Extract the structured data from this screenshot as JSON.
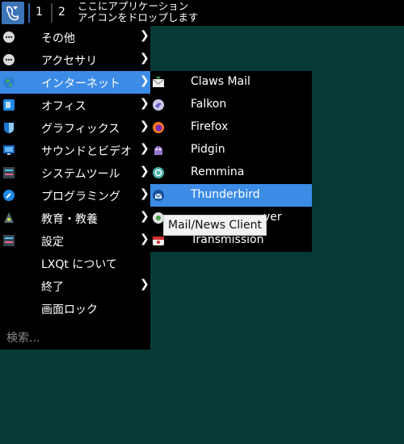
{
  "taskbar": {
    "desktop1": "1",
    "desktop2": "2",
    "hint_line1": "ここにアプリケーション",
    "hint_line2": "アイコンをドロップします",
    "start_icon": "lxqt-logo-icon"
  },
  "menu": {
    "items": [
      {
        "label": "その他",
        "icon": "more-icon",
        "has_submenu": true
      },
      {
        "label": "アクセサリ",
        "icon": "more-icon",
        "has_submenu": true
      },
      {
        "label": "インターネット",
        "icon": "globe-icon",
        "has_submenu": true,
        "active": true
      },
      {
        "label": "オフィス",
        "icon": "office-icon",
        "has_submenu": true
      },
      {
        "label": "グラフィックス",
        "icon": "graphics-icon",
        "has_submenu": true
      },
      {
        "label": "サウンドとビデオ",
        "icon": "monitor-icon",
        "has_submenu": true
      },
      {
        "label": "システムツール",
        "icon": "tools-icon",
        "has_submenu": true
      },
      {
        "label": "プログラミング",
        "icon": "wrench-icon",
        "has_submenu": true
      },
      {
        "label": "教育・教養",
        "icon": "education-icon",
        "has_submenu": true
      },
      {
        "label": "設定",
        "icon": "settings-icon",
        "has_submenu": true
      },
      {
        "label": "LXQt について",
        "icon": "",
        "has_submenu": false
      },
      {
        "label": "終了",
        "icon": "",
        "has_submenu": true
      },
      {
        "label": "画面ロック",
        "icon": "",
        "has_submenu": false
      }
    ],
    "search_placeholder": "検索..."
  },
  "submenu": {
    "items": [
      {
        "label": "Claws Mail",
        "icon": "claws-mail-icon"
      },
      {
        "label": "Falkon",
        "icon": "falkon-icon"
      },
      {
        "label": "Firefox",
        "icon": "firefox-icon"
      },
      {
        "label": "Pidgin",
        "icon": "pidgin-icon"
      },
      {
        "label": "Remmina",
        "icon": "remmina-icon"
      },
      {
        "label": "Thunderbird",
        "icon": "thunderbird-icon",
        "active": true
      },
      {
        "label": "ver",
        "icon": "network-share-icon"
      },
      {
        "label": "Transmission",
        "icon": "transmission-icon"
      }
    ]
  },
  "tooltip": {
    "text": "Mail/News Client"
  },
  "colors": {
    "highlight": "#3c8ce6",
    "desktop": "#073a36",
    "panel": "#000000"
  }
}
